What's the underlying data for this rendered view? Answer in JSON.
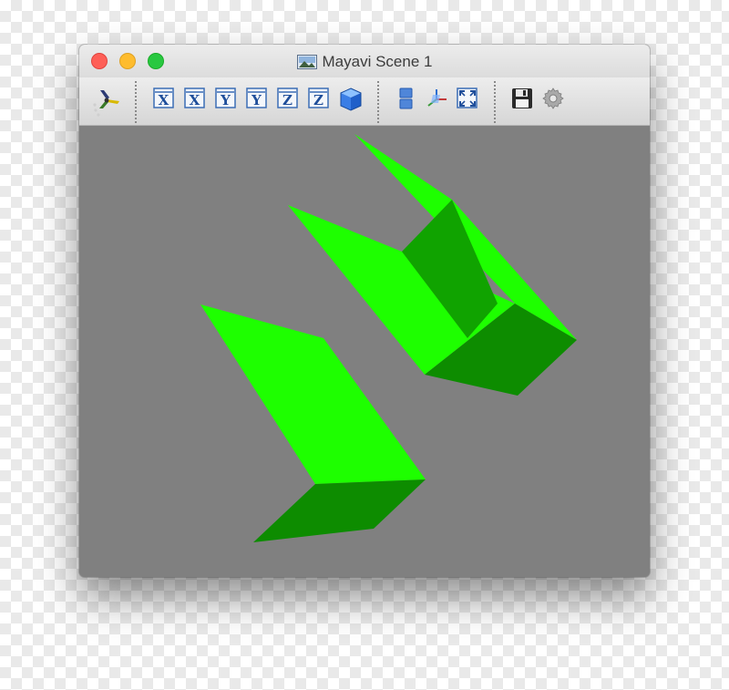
{
  "window": {
    "title": "Mayavi Scene 1"
  },
  "toolbar": {
    "buttons": [
      {
        "name": "mayavi-logo-icon",
        "glyph": ""
      },
      {
        "name": "view-x-pos",
        "glyph": "X"
      },
      {
        "name": "view-x-neg",
        "glyph": "X"
      },
      {
        "name": "view-y-pos",
        "glyph": "Y"
      },
      {
        "name": "view-y-neg",
        "glyph": "Y"
      },
      {
        "name": "view-z-pos",
        "glyph": "Z"
      },
      {
        "name": "view-z-neg",
        "glyph": "Z"
      },
      {
        "name": "isometric-view",
        "glyph": ""
      },
      {
        "name": "parallel-projection",
        "glyph": ""
      },
      {
        "name": "toggle-axes",
        "glyph": ""
      },
      {
        "name": "full-screen",
        "glyph": ""
      },
      {
        "name": "save-scene",
        "glyph": ""
      },
      {
        "name": "configure-scene",
        "glyph": ""
      }
    ]
  },
  "scene": {
    "background_color": "#808080",
    "colors": {
      "bright_green": "#1eff00",
      "mid_green": "#10a300",
      "dark_green": "#0d8c00"
    }
  }
}
